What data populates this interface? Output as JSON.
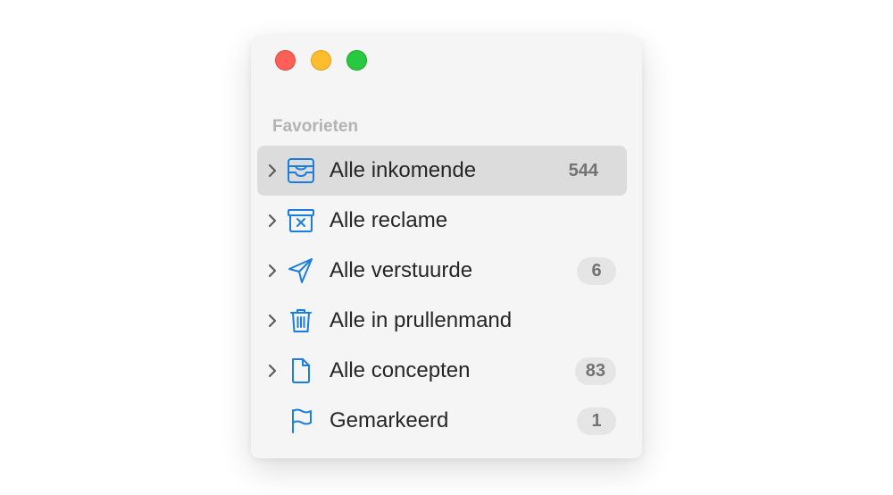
{
  "sidebar": {
    "section_title": "Favorieten",
    "items": [
      {
        "label": "Alle inkomende",
        "count": "544",
        "icon": "inbox-tray-icon",
        "selected": true
      },
      {
        "label": "Alle reclame",
        "count": "",
        "icon": "junk-box-icon",
        "selected": false
      },
      {
        "label": "Alle verstuurde",
        "count": "6",
        "icon": "paper-plane-icon",
        "selected": false
      },
      {
        "label": "Alle in prullenmand",
        "count": "",
        "icon": "trash-can-icon",
        "selected": false
      },
      {
        "label": "Alle concepten",
        "count": "83",
        "icon": "document-icon",
        "selected": false
      },
      {
        "label": "Gemarkeerd",
        "count": "1",
        "icon": "flag-icon",
        "selected": false
      }
    ]
  },
  "colors": {
    "accent": "#1a7ee0",
    "close": "#fe5f57",
    "minimize": "#febc2e",
    "maximize": "#28c840"
  }
}
